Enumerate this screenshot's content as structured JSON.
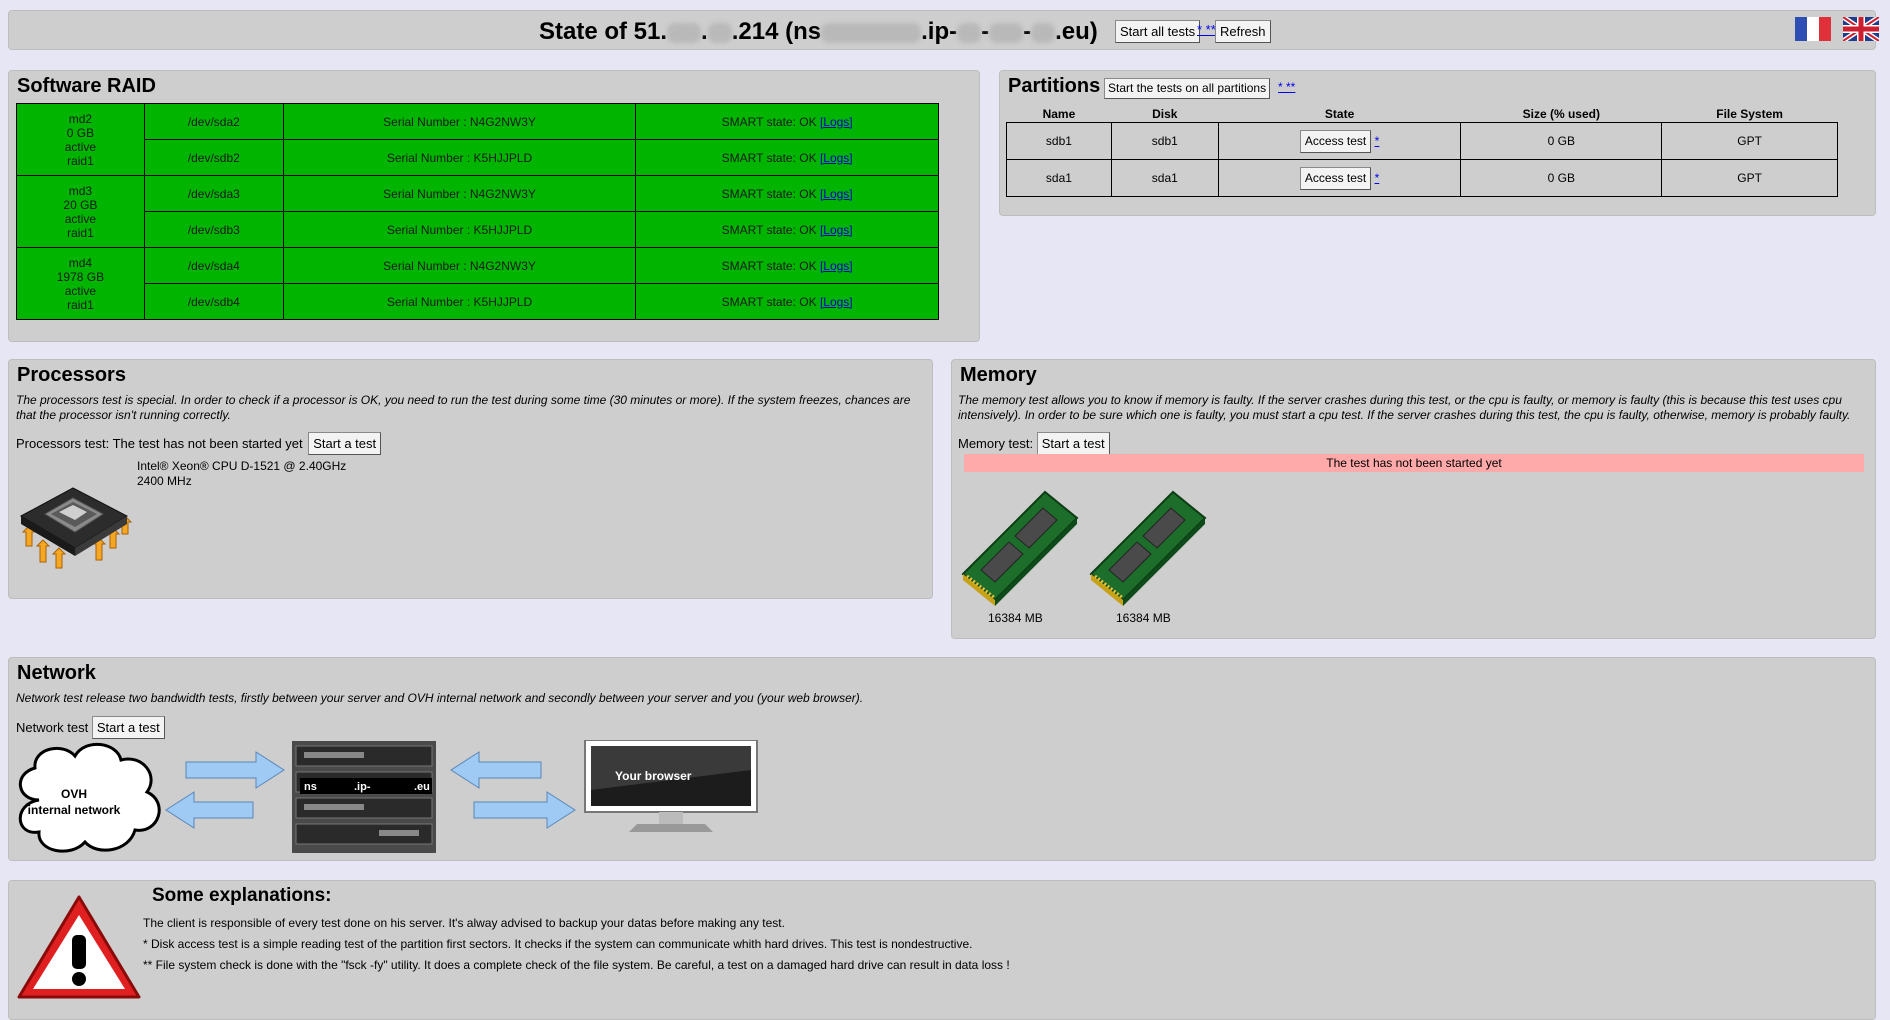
{
  "header": {
    "title_prefix": "State of 51.",
    "title_mid": ".214 (ns",
    "title_mid2": ".ip-",
    "title_suffix": ".eu)",
    "start_all_label": "Start all tests",
    "stars_label": "* **",
    "refresh_label": "Refresh"
  },
  "raid": {
    "title": "Software RAID",
    "arrays": [
      {
        "name": "md2",
        "size": "0 GB",
        "status": "active",
        "level": "raid1",
        "disks": [
          {
            "dev": "/dev/sda2",
            "serial": "Serial Number : N4G2NW3Y",
            "smart": "SMART state: OK",
            "logs": "[Logs]"
          },
          {
            "dev": "/dev/sdb2",
            "serial": "Serial Number : K5HJJPLD",
            "smart": "SMART state: OK",
            "logs": "[Logs]"
          }
        ]
      },
      {
        "name": "md3",
        "size": "20 GB",
        "status": "active",
        "level": "raid1",
        "disks": [
          {
            "dev": "/dev/sda3",
            "serial": "Serial Number : N4G2NW3Y",
            "smart": "SMART state: OK",
            "logs": "[Logs]"
          },
          {
            "dev": "/dev/sdb3",
            "serial": "Serial Number : K5HJJPLD",
            "smart": "SMART state: OK",
            "logs": "[Logs]"
          }
        ]
      },
      {
        "name": "md4",
        "size": "1978 GB",
        "status": "active",
        "level": "raid1",
        "disks": [
          {
            "dev": "/dev/sda4",
            "serial": "Serial Number : N4G2NW3Y",
            "smart": "SMART state: OK",
            "logs": "[Logs]"
          },
          {
            "dev": "/dev/sdb4",
            "serial": "Serial Number : K5HJJPLD",
            "smart": "SMART state: OK",
            "logs": "[Logs]"
          }
        ]
      }
    ]
  },
  "partitions": {
    "title": "Partitions",
    "start_label": "Start the tests on all partitions",
    "stars_label": "* **",
    "columns": [
      "Name",
      "Disk",
      "State",
      "Size (% used)",
      "File System"
    ],
    "rows": [
      {
        "name": "sdb1",
        "disk": "sdb1",
        "button": "Access test",
        "star": "*",
        "size": "0 GB",
        "fs": "GPT"
      },
      {
        "name": "sda1",
        "disk": "sda1",
        "button": "Access test",
        "star": "*",
        "size": "0 GB",
        "fs": "GPT"
      }
    ]
  },
  "processors": {
    "title": "Processors",
    "description": "The processors test is special. In order to check if a processor is OK, you need to run the test during some time (30 minutes or more). If the system freezes, chances are that the processor isn't running correctly.",
    "status_text": "Processors test: The test has not been started yet",
    "start_label": "Start a test",
    "cpu_model": "Intel® Xeon® CPU D-1521 @ 2.40GHz",
    "cpu_freq": "2400 MHz"
  },
  "memory": {
    "title": "Memory",
    "description": "The memory test allows you to know if memory is faulty. If the server crashes during this test, or the cpu is faulty, or memory is faulty (this is because this test uses cpu intensively). In order to be sure which one is faulty, you must start a cpu test. If the server crashes during this test, the cpu is faulty, otherwise, memory is probably faulty.",
    "status_label": "Memory test:",
    "start_label": "Start a test",
    "not_started": "The test has not been started yet",
    "modules": [
      "16384 MB",
      "16384 MB"
    ]
  },
  "network": {
    "title": "Network",
    "description": "Network test release two bandwidth tests, firstly between your server and OVH internal network and secondly between your server and you (your web browser).",
    "status_label": "Network test",
    "start_label": "Start a test",
    "cloud_line1": "OVH",
    "cloud_line2": "internal network",
    "server_label_a": "ns",
    "server_label_b": ".ip-",
    "server_label_c": ".eu",
    "browser_label": "Your browser"
  },
  "explanations": {
    "title": "Some explanations:",
    "lines": [
      "The client is responsible of every test done on his server. It's alway advised to backup your datas before making any test.",
      "* Disk access test is a simple reading test of the partition first sectors. It checks if the system can communicate whith hard drives. This test is nondestructive.",
      "** File system check is done with the \"fsck -fy\" utility. It does a complete check of the file system. Be careful, a test on a damaged hard drive can result in data loss !"
    ]
  },
  "colors": {
    "page_bg": "#e6e6f4",
    "panel_bg": "#cecece",
    "raid_ok": "#00b400",
    "not_started_bg": "#ffaaaa",
    "arrow": "#9fcaf3"
  }
}
